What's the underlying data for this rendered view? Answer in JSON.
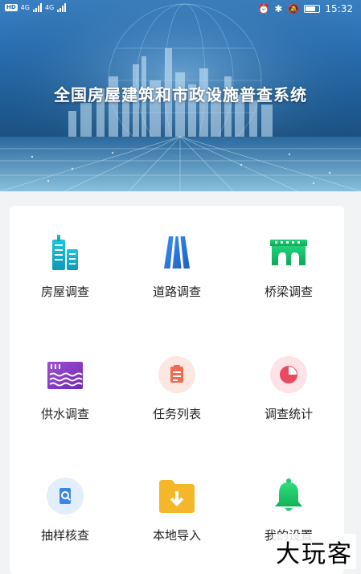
{
  "status_bar": {
    "time": "15:32",
    "network_1": "4G",
    "network_2": "4G",
    "hd_1": "HD",
    "hd_2": "HD"
  },
  "header": {
    "title": "全国房屋建筑和市政设施普查系统"
  },
  "menu": {
    "items": [
      {
        "label": "房屋调查",
        "icon": "building-icon",
        "color": "#16b3c9"
      },
      {
        "label": "道路调查",
        "icon": "road-icon",
        "color": "#2a78d8"
      },
      {
        "label": "桥梁调查",
        "icon": "bridge-icon",
        "color": "#13c26b"
      },
      {
        "label": "供水调查",
        "icon": "water-supply-icon",
        "color": "#8a3fc7"
      },
      {
        "label": "任务列表",
        "icon": "task-list-icon",
        "color": "#f26b4f"
      },
      {
        "label": "调查统计",
        "icon": "pie-chart-icon",
        "color": "#e84a5f"
      },
      {
        "label": "抽样核查",
        "icon": "sample-check-icon",
        "color": "#3b86e0"
      },
      {
        "label": "本地导入",
        "icon": "local-import-folder-icon",
        "color": "#f5b72a"
      },
      {
        "label": "我的设置",
        "icon": "bell-settings-icon",
        "color": "#1fca6a"
      }
    ]
  },
  "watermark": "大玩客"
}
